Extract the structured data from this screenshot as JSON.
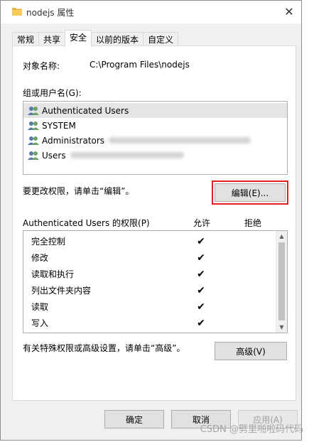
{
  "window": {
    "title": "nodejs 属性",
    "close_label": "✕"
  },
  "tabs": [
    {
      "label": "常规",
      "active": false
    },
    {
      "label": "共享",
      "active": false
    },
    {
      "label": "安全",
      "active": true
    },
    {
      "label": "以前的版本",
      "active": false
    },
    {
      "label": "自定义",
      "active": false
    }
  ],
  "object": {
    "label": "对象名称:",
    "value": "C:\\Program Files\\nodejs"
  },
  "groups": {
    "label": "组或用户名(G):",
    "items": [
      {
        "name": "Authenticated Users",
        "selected": true
      },
      {
        "name": "SYSTEM",
        "selected": false
      },
      {
        "name": "Administrators",
        "selected": false
      },
      {
        "name": "Users",
        "selected": false
      }
    ]
  },
  "edit_hint": "要更改权限，请单击“编辑”。",
  "edit_button": "编辑(E)...",
  "permissions": {
    "header": "Authenticated Users 的权限(P)",
    "allow_label": "允许",
    "deny_label": "拒绝",
    "items": [
      {
        "name": "完全控制",
        "allow": "✔"
      },
      {
        "name": "修改",
        "allow": "✔"
      },
      {
        "name": "读取和执行",
        "allow": "✔"
      },
      {
        "name": "列出文件夹内容",
        "allow": "✔"
      },
      {
        "name": "读取",
        "allow": "✔"
      },
      {
        "name": "写入",
        "allow": "✔"
      }
    ]
  },
  "advanced_hint": "有关特殊权限或高级设置，请单击“高级”。",
  "advanced_button": "高级(V)",
  "footer": {
    "ok": "确定",
    "cancel": "取消",
    "apply": "应用(A)"
  },
  "watermark": "CSDN @劈里啪啦码代码"
}
